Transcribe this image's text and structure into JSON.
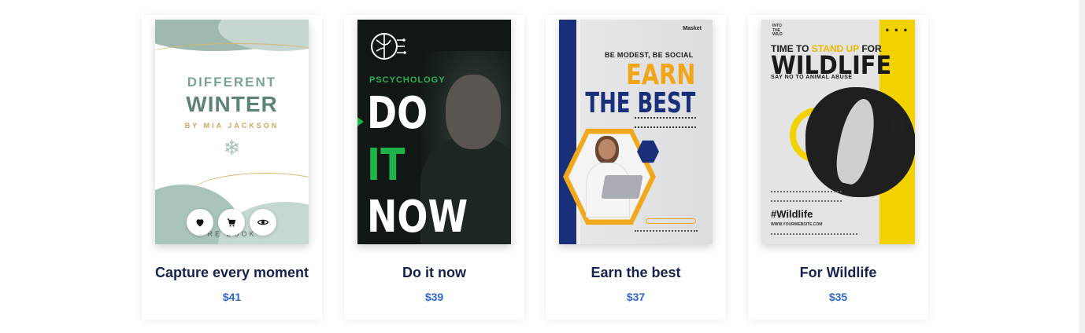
{
  "products": [
    {
      "title": "Capture every moment",
      "price": "$41",
      "cover": {
        "line1": "DIFFERENT",
        "line2": "WINTER",
        "byline": "BY MIA JACKSON",
        "bottom": "RE BOOK"
      }
    },
    {
      "title": "Do it now",
      "price": "$39",
      "cover": {
        "category": "PSCYCHOLOGY",
        "word1": "DO",
        "word2": "IT",
        "word3": "NOW"
      }
    },
    {
      "title": "Earn the best",
      "price": "$37",
      "cover": {
        "brand": "Masket",
        "tagline": "BE MODEST, BE SOCIAL",
        "headline1": "EARN",
        "headline2": "THE BEST"
      }
    },
    {
      "title": "For Wildlife",
      "price": "$35",
      "cover": {
        "logo_line1": "INTO",
        "logo_line2": "THE",
        "logo_line3": "WILD",
        "menu": "• • •",
        "heading_pre": "TIME TO ",
        "heading_highlight": "STAND UP",
        "heading_post": " FOR",
        "heading_big": "WILDLIFE",
        "subheading": "SAY NO TO ANIMAL ABUSE",
        "hashtag": "#Wildlife",
        "website": "WWW.YOURWEBSITE.COM"
      }
    }
  ],
  "hover_actions": {
    "wishlist_icon": "heart-icon",
    "cart_icon": "cart-icon",
    "view_icon": "eye-icon"
  },
  "colors": {
    "title": "#14224d",
    "price": "#3366cc",
    "accent_green": "#1fb34c",
    "accent_navy": "#1a2f7a",
    "accent_yellow": "#f2d300"
  }
}
